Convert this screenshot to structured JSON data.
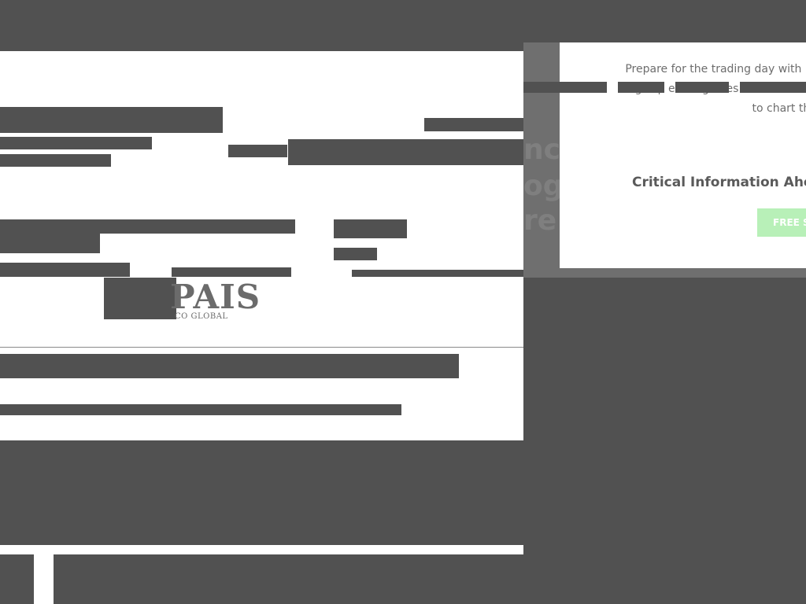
{
  "colors": {
    "background": "#515151",
    "panel": "#ffffff",
    "overlay": "#6f6f6f",
    "accent_button": "#b8f0b8"
  },
  "logo": {
    "name": "PAIS",
    "subtitle": "CO GLOBAL"
  },
  "modal": {
    "body_lines": [
      "Prepare for the trading day with Market",
      "flagship email guides investors to the m",
      "to chart the trad"
    ],
    "heading": "Critical Information Ahead",
    "button_label": "FREE SI"
  },
  "ghost_lines": [
    "nc",
    "og",
    "re"
  ]
}
